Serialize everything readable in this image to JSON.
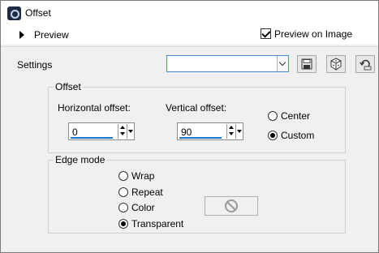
{
  "window": {
    "title": "Offset"
  },
  "preview": {
    "label": "Preview",
    "preview_on_image_label": "Preview on Image",
    "preview_on_image_checked": true
  },
  "settings": {
    "label": "Settings",
    "selected_value": ""
  },
  "offset": {
    "group_label": "Offset",
    "horizontal": {
      "label": "Horizontal offset:",
      "value": "0"
    },
    "vertical": {
      "label": "Vertical offset:",
      "value": "90"
    },
    "mode_options": [
      {
        "label": "Center",
        "selected": false
      },
      {
        "label": "Custom",
        "selected": true
      }
    ]
  },
  "edge_mode": {
    "group_label": "Edge mode",
    "options": [
      {
        "label": "Wrap",
        "selected": false
      },
      {
        "label": "Repeat",
        "selected": false
      },
      {
        "label": "Color",
        "selected": false
      },
      {
        "label": "Transparent",
        "selected": true
      }
    ]
  },
  "colors": {
    "accent": "#1e74d2",
    "background": "#f0f0f0"
  },
  "icons": [
    "window-icon",
    "expand-triangle-icon",
    "checkbox-icon",
    "save-icon",
    "randomize-dice-icon",
    "reset-icon",
    "spin-up-icon",
    "spin-down-icon",
    "dropdown-icon",
    "disabled-icon"
  ]
}
